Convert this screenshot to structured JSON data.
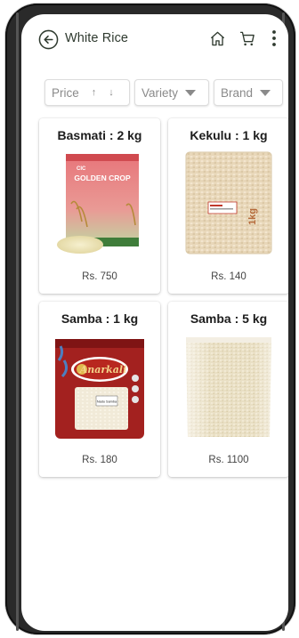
{
  "header": {
    "title": "White Rice"
  },
  "filters": {
    "price_label": "Price",
    "price_up": "↑",
    "price_down": "↓",
    "variety_label": "Variety",
    "brand_label": "Brand"
  },
  "products": [
    {
      "title": "Basmati : 2 kg",
      "price": "Rs. 750",
      "pack_brand": "CIC",
      "pack_name": "GOLDEN CROP"
    },
    {
      "title": "Kekulu : 1 kg",
      "price": "Rs. 140",
      "pack_mark": "1kg"
    },
    {
      "title": "Samba : 1 kg",
      "price": "Rs. 180",
      "pack_brand": "Anarkali",
      "pack_tag": "Nadu Samba"
    },
    {
      "title": "Samba : 5 kg",
      "price": "Rs. 1100"
    }
  ],
  "colors": {
    "accent": "#2f5d3a",
    "golden_crop_red": "#d9534f",
    "anarkali_red": "#9b1c1c"
  }
}
